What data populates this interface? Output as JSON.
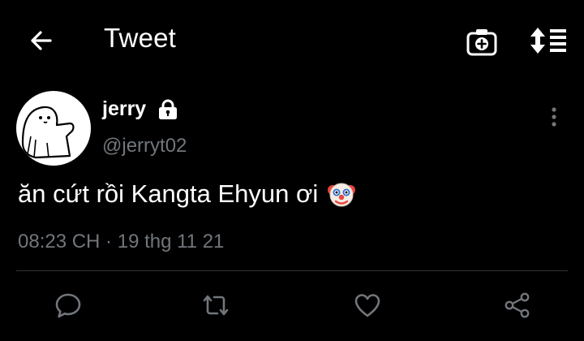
{
  "appbar": {
    "title": "Tweet",
    "icons": {
      "back": "arrow-left",
      "camera": "camera-plus",
      "sort": "sort-arrows-list"
    }
  },
  "tweet": {
    "author": {
      "display_name": "jerry",
      "handle": "@jerryt02",
      "protected_icon": "lock"
    },
    "text": "ăn cứt rồi Kangta Ehyun ơi",
    "emoji": "clown-face",
    "meta": "08:23 CH · 19 thg 11 21"
  },
  "actions": [
    {
      "icon": "reply-bubble"
    },
    {
      "icon": "retweet"
    },
    {
      "icon": "heart"
    },
    {
      "icon": "share"
    }
  ],
  "colors": {
    "background": "#000000",
    "primary_text": "#ffffff",
    "secondary_text": "#71767b",
    "icon": "#71767b",
    "divider": "#2f3336"
  }
}
